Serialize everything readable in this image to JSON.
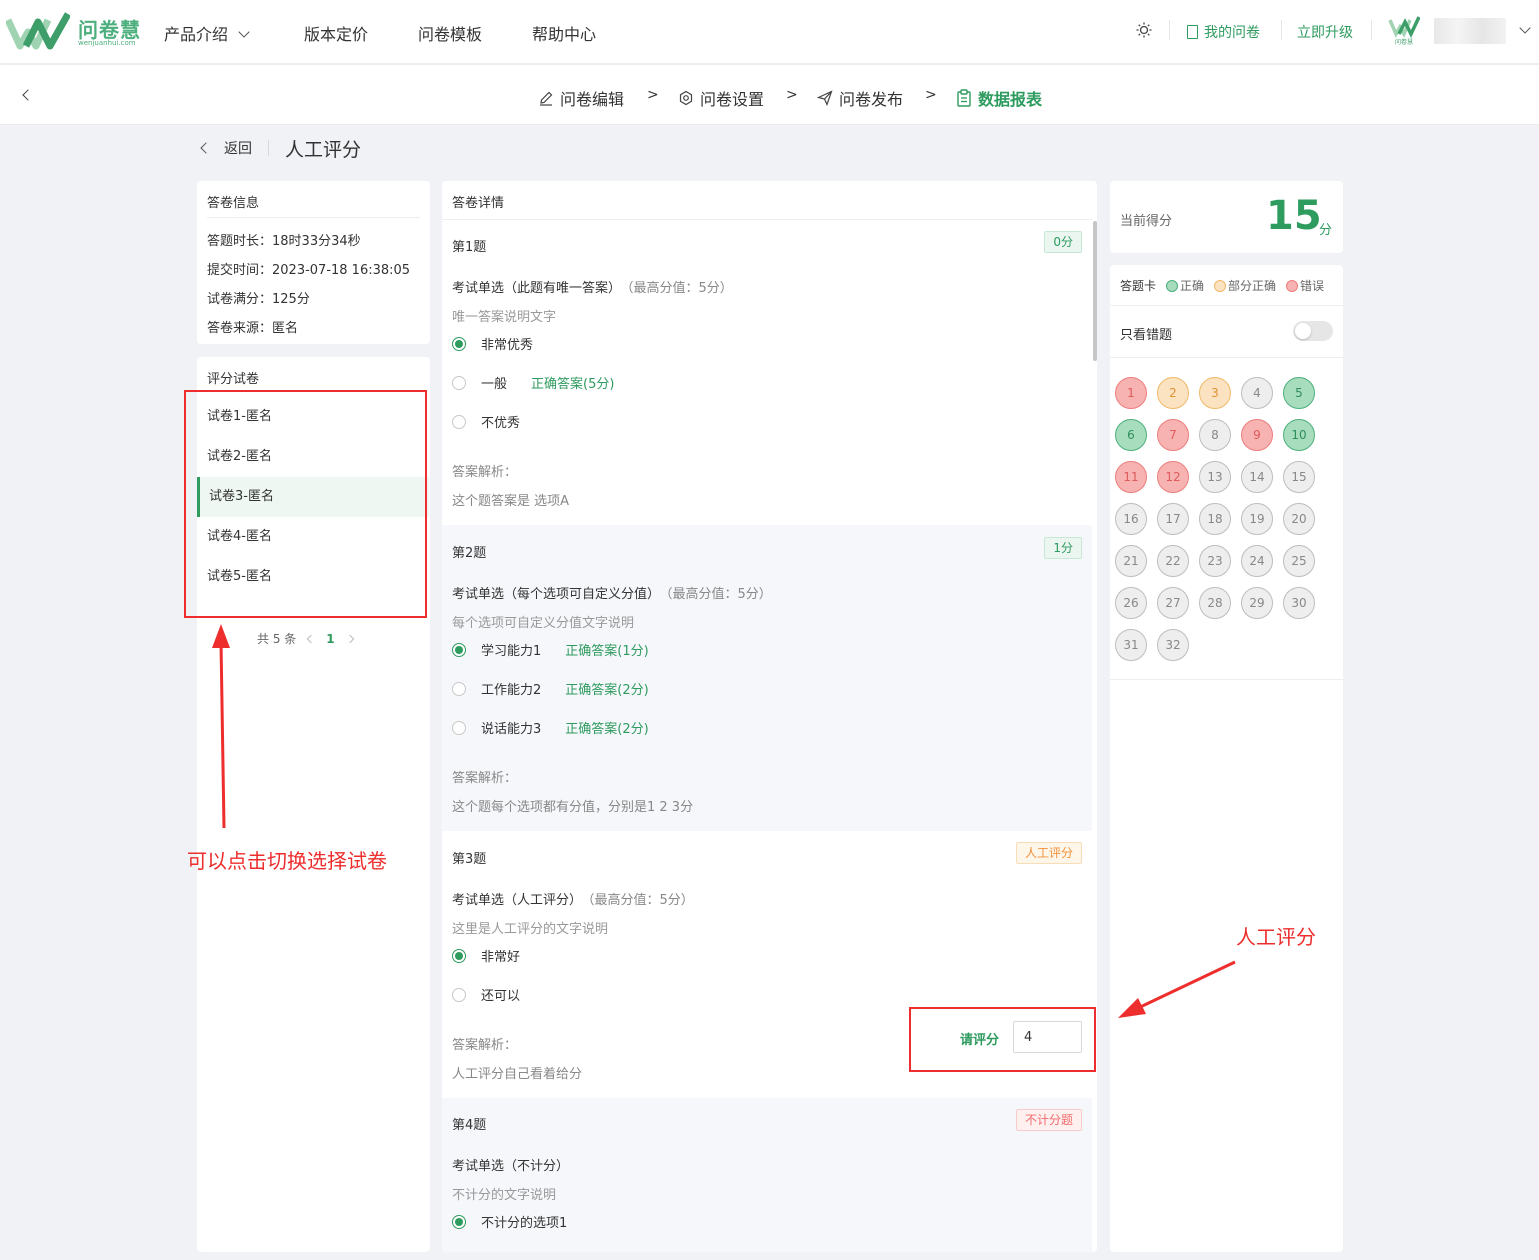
{
  "brand": {
    "name": "问卷慧",
    "domain": "wenjuanhui.com",
    "color": "#4caf7d"
  },
  "topnav": {
    "items": [
      "产品介绍",
      "版本定价",
      "问卷模板",
      "帮助中心"
    ],
    "my_surveys": "我的问卷",
    "upgrade": "立即升级",
    "avatar_logo_text": "问卷慧"
  },
  "steps": [
    "问卷编辑",
    "问卷设置",
    "问卷发布",
    "数据报表"
  ],
  "step_separator": ">",
  "subheader": {
    "back": "返回",
    "title": "人工评分"
  },
  "answer_info": {
    "title": "答卷信息",
    "rows": [
      "答题时长：18时33分34秒",
      "提交时间：2023-07-18 16:38:05",
      "试卷满分：125分",
      "答卷来源：匿名"
    ]
  },
  "grading": {
    "title": "评分试卷",
    "papers": [
      "试卷1-匿名",
      "试卷2-匿名",
      "试卷3-匿名",
      "试卷4-匿名",
      "试卷5-匿名"
    ],
    "active_index": 2,
    "pager_total": "共 5 条",
    "pager_current": "1"
  },
  "detail": {
    "title": "答卷详情",
    "questions": [
      {
        "no": "第1题",
        "tag": "0分",
        "title": "考试单选（此题有唯一答案）",
        "max": "（最高分值：5分）",
        "desc": "唯一答案说明文字",
        "options": [
          {
            "label": "非常优秀",
            "note": ""
          },
          {
            "label": "一般",
            "note": "正确答案(5分)"
          },
          {
            "label": "不优秀",
            "note": ""
          }
        ],
        "analysis_label": "答案解析：",
        "analysis": "这个题答案是 选项A"
      },
      {
        "no": "第2题",
        "tag": "1分",
        "title": "考试单选（每个选项可自定义分值）",
        "max": "（最高分值：5分）",
        "desc": "每个选项可自定义分值文字说明",
        "options": [
          {
            "label": "学习能力1",
            "note": "正确答案(1分)"
          },
          {
            "label": "工作能力2",
            "note": "正确答案(2分)"
          },
          {
            "label": "说话能力3",
            "note": "正确答案(2分)"
          }
        ],
        "analysis_label": "答案解析：",
        "analysis": "这个题每个选项都有分值，分别是1 2 3分"
      },
      {
        "no": "第3题",
        "tag": "人工评分",
        "title": "考试单选（人工评分）",
        "max": "（最高分值：5分）",
        "desc": "这里是人工评分的文字说明",
        "options": [
          {
            "label": "非常好",
            "note": ""
          },
          {
            "label": "还可以",
            "note": ""
          }
        ],
        "analysis_label": "答案解析：",
        "analysis": "人工评分自己看着给分",
        "score_label": "请评分",
        "score_value": "4"
      },
      {
        "no": "第4题",
        "tag": "不计分题",
        "title": "考试单选（不计分）",
        "max": "",
        "desc": "不计分的文字说明",
        "options": [
          {
            "label": "不计分的选项1",
            "note": ""
          }
        ]
      }
    ]
  },
  "score": {
    "caption": "当前得分",
    "value": "15",
    "unit": "分"
  },
  "answer_card": {
    "title": "答题卡",
    "legend": [
      "正确",
      "部分正确",
      "错误"
    ],
    "only_wrong": "只看错题",
    "cells": [
      {
        "n": "1",
        "s": "bad"
      },
      {
        "n": "2",
        "s": "part"
      },
      {
        "n": "3",
        "s": "part"
      },
      {
        "n": "4",
        "s": "none"
      },
      {
        "n": "5",
        "s": "ok"
      },
      {
        "n": "6",
        "s": "ok"
      },
      {
        "n": "7",
        "s": "bad"
      },
      {
        "n": "8",
        "s": "none"
      },
      {
        "n": "9",
        "s": "bad"
      },
      {
        "n": "10",
        "s": "ok"
      },
      {
        "n": "11",
        "s": "bad"
      },
      {
        "n": "12",
        "s": "bad"
      },
      {
        "n": "13",
        "s": "none"
      },
      {
        "n": "14",
        "s": "none"
      },
      {
        "n": "15",
        "s": "none"
      },
      {
        "n": "16",
        "s": "none"
      },
      {
        "n": "17",
        "s": "none"
      },
      {
        "n": "18",
        "s": "none"
      },
      {
        "n": "19",
        "s": "none"
      },
      {
        "n": "20",
        "s": "none"
      },
      {
        "n": "21",
        "s": "none"
      },
      {
        "n": "22",
        "s": "none"
      },
      {
        "n": "23",
        "s": "none"
      },
      {
        "n": "24",
        "s": "none"
      },
      {
        "n": "25",
        "s": "none"
      },
      {
        "n": "26",
        "s": "none"
      },
      {
        "n": "27",
        "s": "none"
      },
      {
        "n": "28",
        "s": "none"
      },
      {
        "n": "29",
        "s": "none"
      },
      {
        "n": "30",
        "s": "none"
      },
      {
        "n": "31",
        "s": "none"
      },
      {
        "n": "32",
        "s": "none"
      }
    ]
  },
  "annotations": {
    "switch_paper": "可以点击切换选择试卷",
    "manual_score": "人工评分",
    "color": "#ee2d2d"
  }
}
